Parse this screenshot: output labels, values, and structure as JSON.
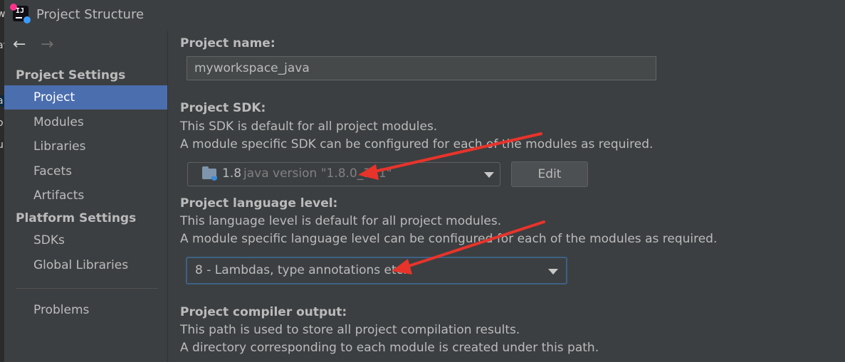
{
  "window": {
    "title": "Project Structure"
  },
  "left_edge_chars": [
    "w",
    "av",
    "a",
    "o",
    "u"
  ],
  "nav": {
    "back_icon": "arrow-left-icon",
    "forward_icon": "arrow-right-icon"
  },
  "sidebar": {
    "project_settings": "Project Settings",
    "project_items": [
      "Project",
      "Modules",
      "Libraries",
      "Facets",
      "Artifacts"
    ],
    "platform_settings": "Platform Settings",
    "platform_items": [
      "SDKs",
      "Global Libraries"
    ],
    "problems": "Problems",
    "selected": "Project"
  },
  "content": {
    "name_label": "Project name:",
    "name_value": "myworkspace_java",
    "sdk_label": "Project SDK:",
    "sdk_desc1": "This SDK is default for all project modules.",
    "sdk_desc2": "A module specific SDK can be configured for each of the modules as required.",
    "sdk_version": "1.8",
    "sdk_detail": "java version \"1.8.0_321\"",
    "edit_label": "Edit",
    "lang_label": "Project language level:",
    "lang_desc1": "This language level is default for all project modules.",
    "lang_desc2": "A module specific language level can be configured for each of the modules as required.",
    "lang_value": "8 - Lambdas, type annotations etc.",
    "compiler_label": "Project compiler output:",
    "compiler_desc1": "This path is used to store all project compilation results.",
    "compiler_desc2": "A directory corresponding to each module is created under this path."
  },
  "colors": {
    "accent": "#4b6eaf",
    "annotation": "#e8332b"
  }
}
